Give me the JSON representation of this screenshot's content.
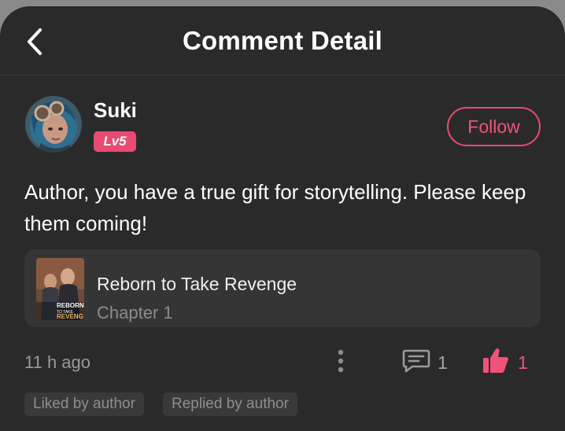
{
  "header": {
    "title": "Comment Detail"
  },
  "comment": {
    "user": {
      "name": "Suki",
      "level": "Lv5",
      "follow_label": "Follow"
    },
    "text": "Author, you have a true gift for storytelling. Please keep them coming!",
    "book": {
      "title": "Reborn to Take Revenge",
      "chapter": "Chapter 1",
      "cover_text_line1": "REBORN",
      "cover_text_line2": "TO TAKE",
      "cover_text_line3": "REVENG"
    },
    "time": "11 h ago",
    "reply_count": "1",
    "like_count": "1",
    "tags": [
      "Liked by author",
      "Replied by author"
    ]
  },
  "colors": {
    "accent": "#e94a72",
    "background": "#2b2a2b",
    "card": "#363536"
  },
  "icons": {
    "back": "chevron-left-icon",
    "more": "vertical-dots-icon",
    "comment": "speech-bubble-icon",
    "like": "thumbs-up-icon"
  }
}
